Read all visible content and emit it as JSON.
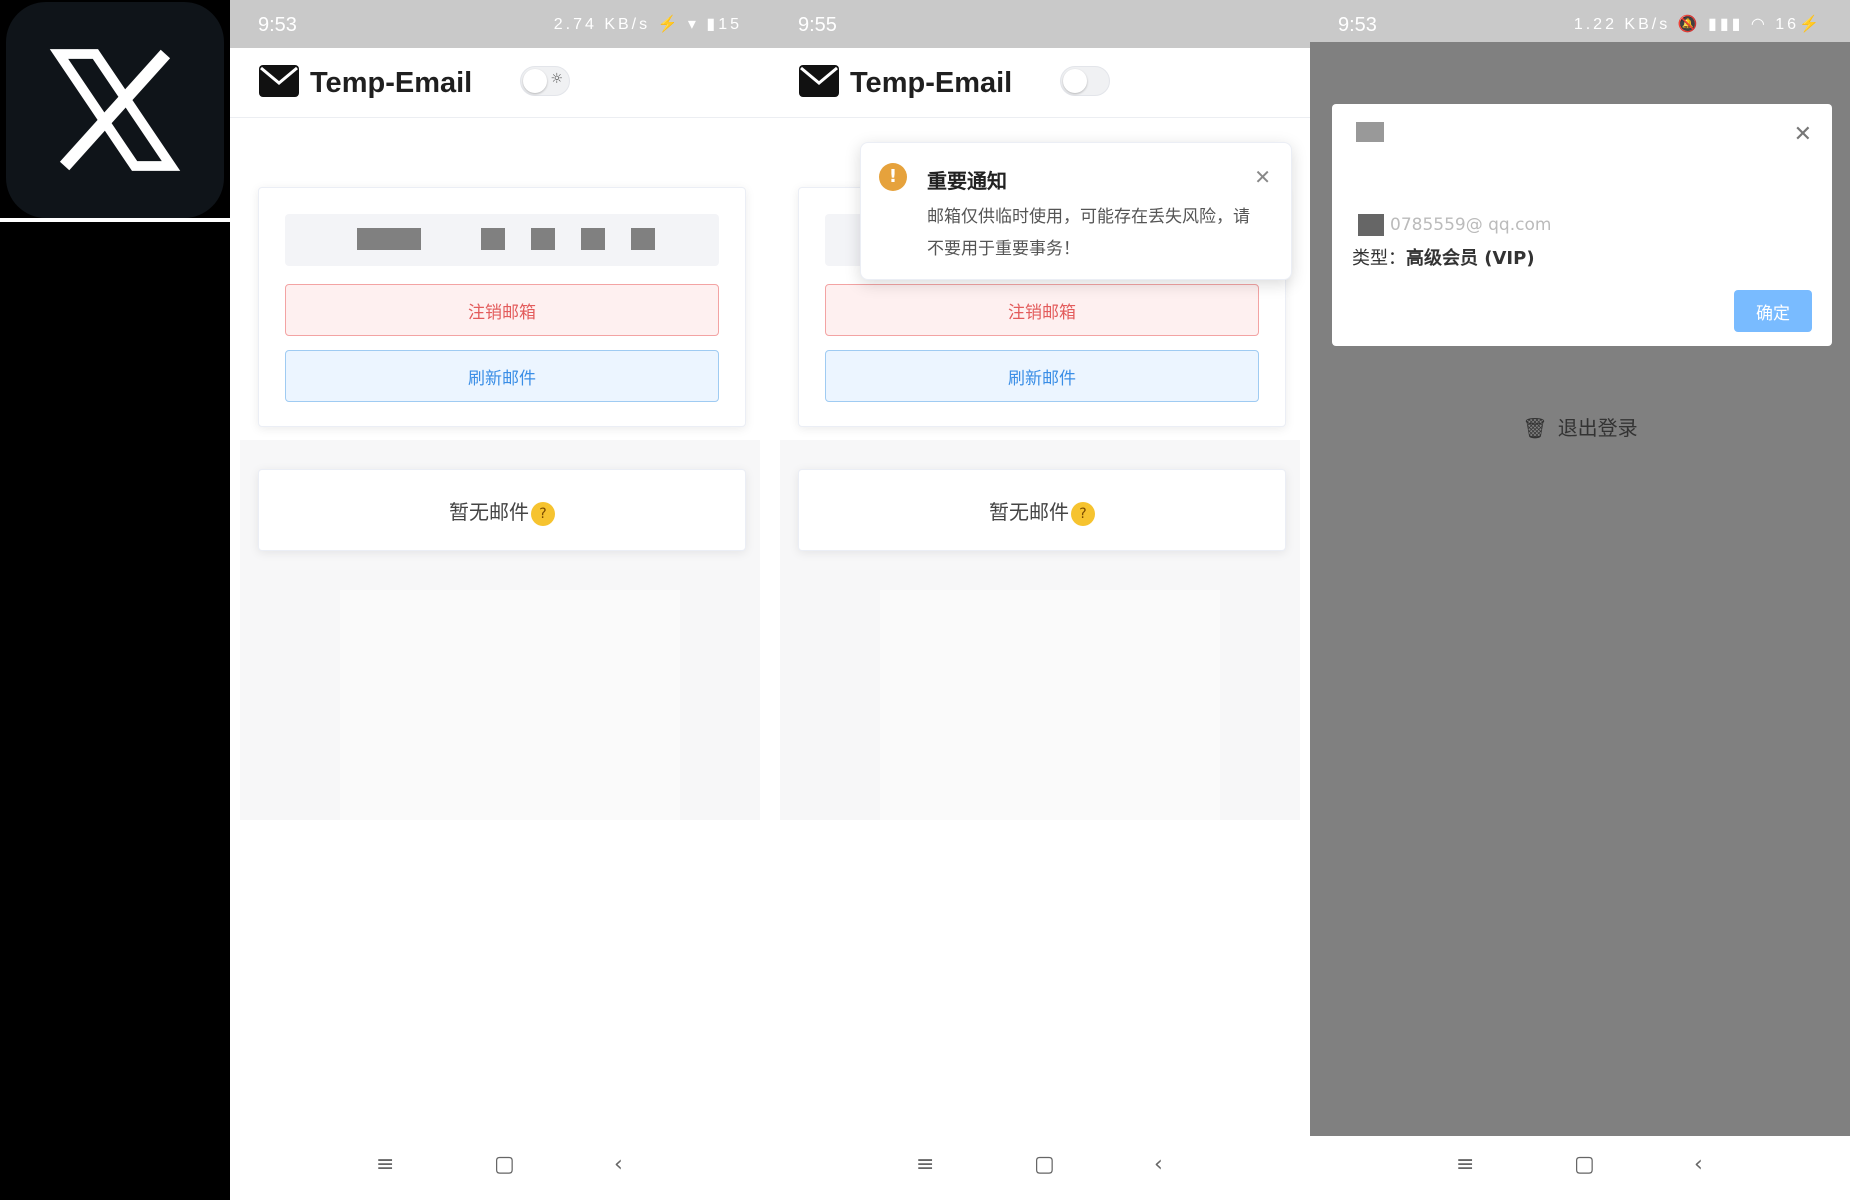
{
  "app": {
    "title": "Temp-Email"
  },
  "panels": [
    {
      "status": {
        "time": "9:53",
        "icons": "2.74 KB/s ⚡ ▾ ▮15"
      },
      "buttons": {
        "deregister": "注销邮箱",
        "refresh": "刷新邮件"
      },
      "empty_text": "暂无邮件"
    },
    {
      "status": {
        "time": "9:55",
        "icons": ""
      },
      "buttons": {
        "deregister": "注销邮箱",
        "refresh": "刷新邮件"
      },
      "empty_text": "暂无邮件",
      "notice": {
        "title": "重要通知",
        "body": "邮箱仅供临时使用，可能存在丢失风险，请不要用于重要事务！"
      }
    },
    {
      "status": {
        "time": "9:53",
        "icons": "1.22 KB/s 🔕 ▮▮▮ ◠ 16⚡"
      },
      "dialog": {
        "email_partial": "0785559@ qq.com",
        "type_label": "类型：",
        "type_value": "高级会员 (VIP)",
        "ok_label": "确定"
      },
      "logout_label": "退出登录"
    }
  ],
  "icons": {
    "logo": "x-logo-icon",
    "mail": "envelope-icon",
    "theme": "sun-icon",
    "warning": "exclamation-icon",
    "close": "close-icon",
    "trash": "trash-icon",
    "nav_menu": "menu-icon",
    "nav_home": "square-icon",
    "nav_back": "chevron-left-icon",
    "emoji": "thinking-face-icon"
  },
  "colors": {
    "danger": "#e35c5c",
    "primary": "#3a8ee6",
    "warning": "#e6a23c",
    "ok_button": "#79bbff"
  }
}
